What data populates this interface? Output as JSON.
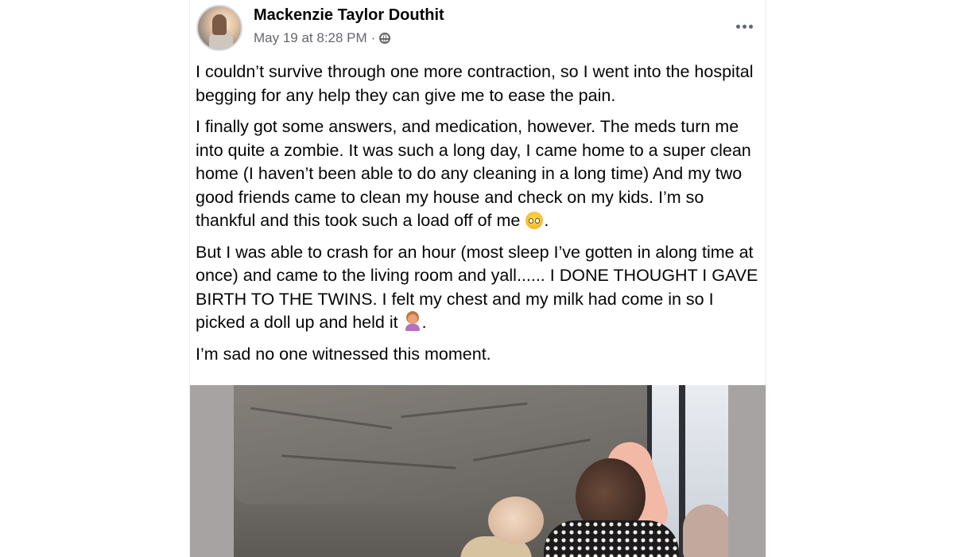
{
  "post": {
    "author": "Mackenzie Taylor Douthit",
    "timestamp": "May 19 at 8:28 PM",
    "separator": "·",
    "audience_icon": "globe-icon",
    "more_icon": "more-horizontal-icon",
    "paragraphs": {
      "p1": "I couldn’t survive through one more contraction, so I went into the hospital begging for any help they can give me to ease the pain.",
      "p2_text": "I finally got some answers, and medication, however. The meds turn me into quite a zombie. It was such a long day, I came home to a super clean home (I haven’t been able to do any cleaning in a long time) And my two good friends came to clean my house and check on my kids. I’m so thankful and this took such a load off of me",
      "p2_end": ".",
      "p3_text": "But I was able to crash for an hour (most sleep I’ve gotten in along time at once) and came to the living room and yall...... I DONE THOUGHT I GAVE BIRTH TO THE TWINS. I felt my chest and my milk had come in so I picked a doll up and held it",
      "p3_end": ".",
      "p4": "I’m sad no one witnessed this moment."
    },
    "emojis": {
      "p2": "teary-eyed-face-emoji",
      "p3": "woman-facepalming-emoji"
    },
    "photo": {
      "subject": "two baby dolls on a gray couch"
    }
  }
}
